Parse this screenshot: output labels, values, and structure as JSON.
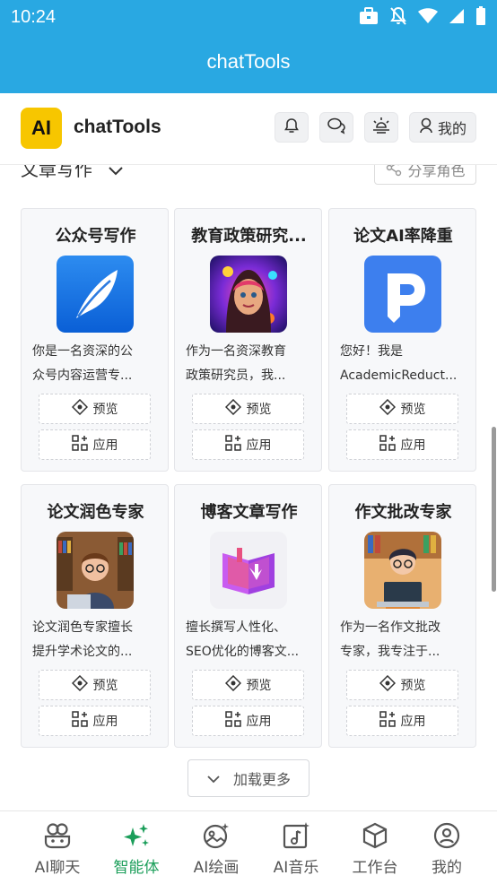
{
  "status": {
    "time": "10:24"
  },
  "appbar": {
    "title": "chatTools"
  },
  "header": {
    "logo_text": "AI",
    "brand": "chatTools",
    "me_label": "我的"
  },
  "section": {
    "title": "文章写作",
    "share_label": "分享角色"
  },
  "cards": [
    {
      "title": "公众号写作",
      "desc1": "你是一名资深的公",
      "desc2": "众号内容运营专...",
      "preview": "预览",
      "use": "应用",
      "icon": "feather-icon"
    },
    {
      "title": "教育政策研究...",
      "desc1": "作为一名资深教育",
      "desc2": "政策研究员，我...",
      "preview": "预览",
      "use": "应用",
      "icon": "avatar-girl-icon"
    },
    {
      "title": "论文AI率降重",
      "desc1": "您好！我是",
      "desc2": "AcademicReduct...",
      "preview": "预览",
      "use": "应用",
      "icon": "p-pen-icon"
    },
    {
      "title": "论文润色专家",
      "desc1": "论文润色专家擅长",
      "desc2": "提升学术论文的...",
      "preview": "预览",
      "use": "应用",
      "icon": "scholar-icon"
    },
    {
      "title": "博客文章写作",
      "desc1": "擅长撰写人性化、",
      "desc2": "SEO优化的博客文...",
      "preview": "预览",
      "use": "应用",
      "icon": "book-icon"
    },
    {
      "title": "作文批改专家",
      "desc1": "作为一名作文批改",
      "desc2": "专家，我专注于...",
      "preview": "预览",
      "use": "应用",
      "icon": "student-laptop-icon"
    }
  ],
  "load_more": "加载更多",
  "nav": [
    {
      "label": "AI聊天",
      "icon": "chat-bot-icon"
    },
    {
      "label": "智能体",
      "icon": "sparkles-icon",
      "active": true
    },
    {
      "label": "AI绘画",
      "icon": "image-icon"
    },
    {
      "label": "AI音乐",
      "icon": "music-icon"
    },
    {
      "label": "工作台",
      "icon": "cube-icon"
    },
    {
      "label": "我的",
      "icon": "user-icon"
    }
  ],
  "colors": {
    "primary": "#29a8e2",
    "accent": "#1b9e5a",
    "logo": "#f7c600"
  }
}
